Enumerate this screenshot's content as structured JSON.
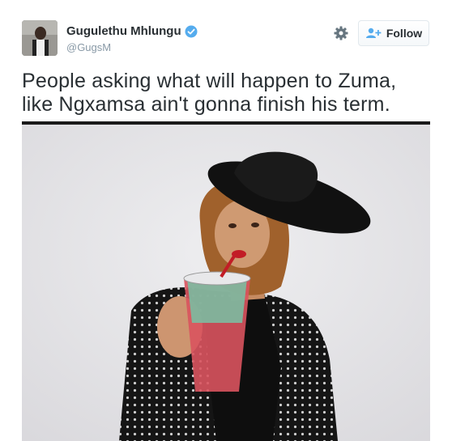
{
  "tweet": {
    "author_name": "Gugulethu Mhlungu",
    "author_handle": "@GugsM",
    "verified": true,
    "follow_label": "Follow",
    "text_line1": "People asking what will happen to Zuma,",
    "text_line2": "like Ngxamsa ain't gonna finish his term."
  },
  "colors": {
    "verified": "#55acee",
    "follow_icon": "#55acee",
    "text": "#292f33",
    "handle": "#8899a6"
  },
  "icons": [
    "avatar",
    "verified-badge-icon",
    "gear-icon",
    "follow-user-icon"
  ]
}
